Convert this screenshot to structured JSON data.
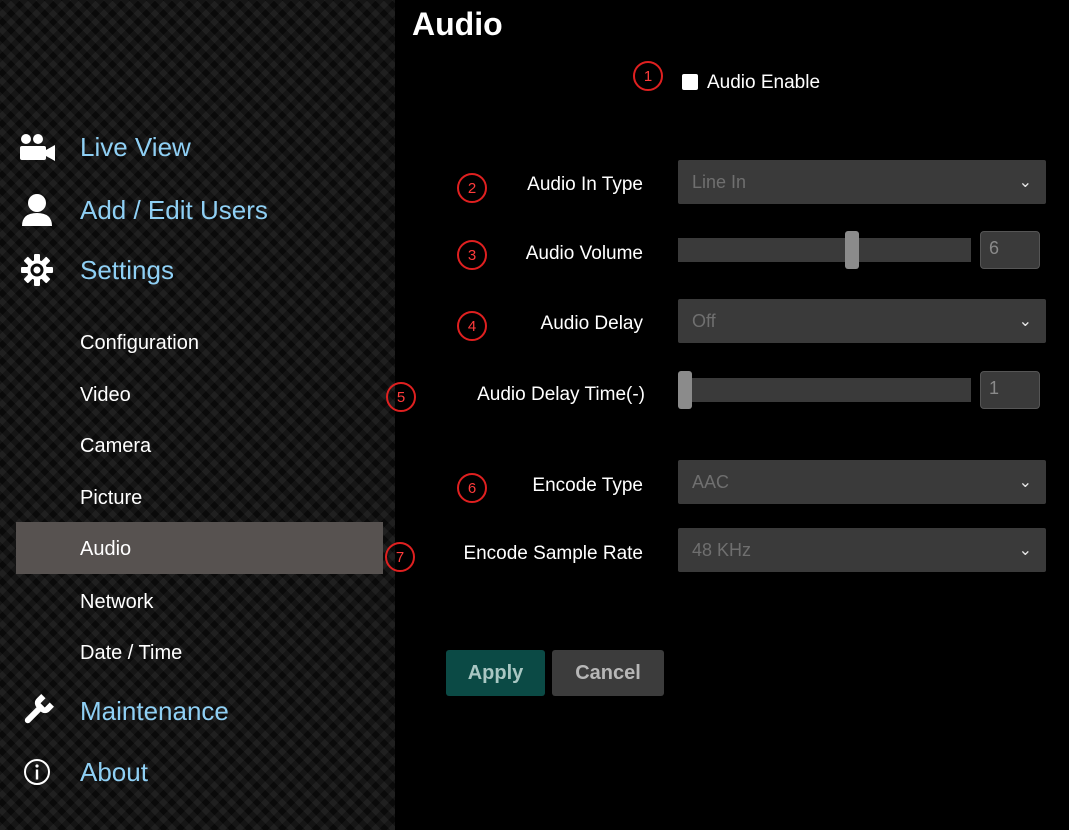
{
  "page": {
    "title": "Audio"
  },
  "sidebar": {
    "main_items": [
      {
        "label": "Live View",
        "icon": "video-camera-icon"
      },
      {
        "label": "Add / Edit Users",
        "icon": "user-icon"
      },
      {
        "label": "Settings",
        "icon": "gear-icon"
      },
      {
        "label": "Maintenance",
        "icon": "wrench-icon"
      },
      {
        "label": "About",
        "icon": "info-icon"
      }
    ],
    "sub_items": [
      {
        "label": "Configuration"
      },
      {
        "label": "Video"
      },
      {
        "label": "Camera"
      },
      {
        "label": "Picture"
      },
      {
        "label": "Audio",
        "active": true
      },
      {
        "label": "Network"
      },
      {
        "label": "Date / Time"
      }
    ],
    "colors": {
      "main_text": "#8fd0f5",
      "active_bg": "#575250"
    }
  },
  "form": {
    "audio_enable": {
      "badge": "1",
      "label": "Audio Enable",
      "checked": false
    },
    "audio_in_type": {
      "badge": "2",
      "label": "Audio In Type",
      "value": "Line In"
    },
    "audio_volume": {
      "badge": "3",
      "label": "Audio Volume",
      "value": "6"
    },
    "audio_delay": {
      "badge": "4",
      "label": "Audio Delay",
      "value": "Off"
    },
    "audio_delay_time": {
      "badge": "5",
      "label": "Audio Delay Time(-)",
      "value": "1"
    },
    "encode_type": {
      "badge": "6",
      "label": "Encode Type",
      "value": "AAC"
    },
    "encode_sample_rate": {
      "badge": "7",
      "label": "Encode Sample Rate",
      "value": "48 KHz"
    }
  },
  "buttons": {
    "apply": "Apply",
    "cancel": "Cancel"
  },
  "colors": {
    "badge": "#e02020",
    "apply_bg": "#0b4a45",
    "apply_text": "#a9c7c3",
    "cancel_bg": "#3c3c3c",
    "cancel_text": "#b7b7b7"
  }
}
